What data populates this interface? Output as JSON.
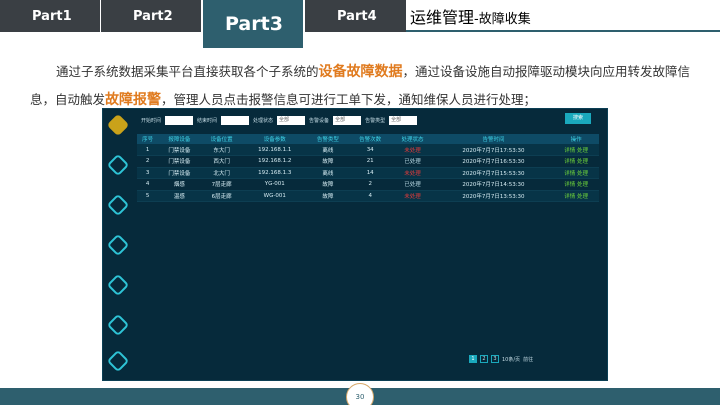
{
  "tabs": [
    "Part1",
    "Part2",
    "Part3",
    "Part4"
  ],
  "title": "运维管理",
  "subtitle": "-故障收集",
  "desc": {
    "p1": "通过子系统数据采集平台直接获取各个子系统的",
    "h1": "设备故障数据",
    "p2": "，通过设备设施自动报障驱动模块向应用转发故障信息，自动触发",
    "h2": "故障报警",
    "p3": "，管理人员点击报警信息可进行工单下发，通知维保人员进行处理；"
  },
  "filters": [
    {
      "label": "开始时间",
      "value": ""
    },
    {
      "label": "结束时间",
      "value": ""
    },
    {
      "label": "处理状态",
      "value": "全部"
    },
    {
      "label": "告警设备",
      "value": "全部"
    },
    {
      "label": "告警类型",
      "value": "全部"
    }
  ],
  "search_label": "搜索",
  "columns": [
    "序号",
    "报障设备",
    "设备位置",
    "设备参数",
    "告警类型",
    "告警次数",
    "处理状态",
    "告警时间",
    "操作"
  ],
  "rows": [
    [
      "1",
      "门禁设备",
      "东大门",
      "192.168.1.1",
      "离线",
      "34",
      "未处理",
      "2020年7月7日17:53:30",
      "详情 处理"
    ],
    [
      "2",
      "门禁设备",
      "西大门",
      "192.168.1.2",
      "故障",
      "21",
      "已处理",
      "2020年7月7日16:53:30",
      "详情 处理"
    ],
    [
      "3",
      "门禁设备",
      "北大门",
      "192.168.1.3",
      "离线",
      "14",
      "未处理",
      "2020年7月7日15:53:30",
      "详情 处理"
    ],
    [
      "4",
      "烟感",
      "7层走廊",
      "YG-001",
      "故障",
      "2",
      "已处理",
      "2020年7月7日14:53:30",
      "详情 处理"
    ],
    [
      "5",
      "温感",
      "6层走廊",
      "WG-001",
      "故障",
      "4",
      "未处理",
      "2020年7月7日13:53:30",
      "详情 处理"
    ]
  ],
  "status_colors": {
    "未处理": "#e13b3b",
    "已处理": "#b8d8e2"
  },
  "pager": {
    "pages": [
      "1",
      "2",
      "3"
    ],
    "per_page": "10条/页",
    "goto": "前往",
    "current": "1"
  },
  "page_number": "30"
}
